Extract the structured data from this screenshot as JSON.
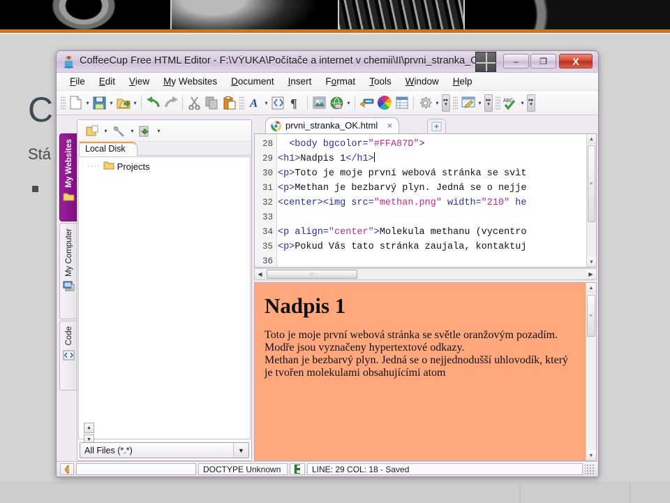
{
  "slide": {
    "title_visible": "C",
    "subtitle_visible": "Stá",
    "accent_color": "#c8761f",
    "background_color": "#d3d3d3"
  },
  "window": {
    "title": "CoffeeCup Free HTML Editor - F:\\VÝUKA\\Počítače a internet v chemii\\II\\prvni_stranka_OK.html",
    "app_icon": "coffeecup-icon",
    "controls": {
      "minimize": "–",
      "maximize": "❐",
      "close": "X"
    }
  },
  "menubar": {
    "items": [
      {
        "label": "File",
        "accel": "F"
      },
      {
        "label": "Edit",
        "accel": "E"
      },
      {
        "label": "View",
        "accel": "V"
      },
      {
        "label": "My Websites",
        "accel": "M"
      },
      {
        "label": "Document",
        "accel": "D"
      },
      {
        "label": "Insert",
        "accel": "I"
      },
      {
        "label": "Format",
        "accel": "o"
      },
      {
        "label": "Tools",
        "accel": "T"
      },
      {
        "label": "Window",
        "accel": "W"
      },
      {
        "label": "Help",
        "accel": "H"
      }
    ]
  },
  "toolbar": {
    "buttons": [
      "new-page-icon",
      "save-icon",
      "open-folder-icon",
      "undo-icon",
      "redo-icon",
      "cut-icon",
      "copy-icon",
      "paste-icon",
      "font-icon",
      "code-cleanup-icon",
      "paragraph-mark-icon",
      "insert-image-icon",
      "insert-link-icon",
      "anchor-icon",
      "color-wheel-icon",
      "insert-table-icon",
      "settings-gear-icon",
      "preview-edit-icon",
      "spellcheck-icon"
    ]
  },
  "sidebar": {
    "vertical_tabs": [
      {
        "label": "My Websites",
        "icon": "folder-icon",
        "active": true
      },
      {
        "label": "My Computer",
        "icon": "computer-icon",
        "active": false
      },
      {
        "label": "Code",
        "icon": "code-icon",
        "active": false
      }
    ],
    "panel_toolbar": [
      "open-project-icon",
      "tools-wrench-icon",
      "upload-icon"
    ],
    "tab": "Local Disk",
    "tree": [
      {
        "label": "Projects",
        "icon": "folder-icon"
      }
    ],
    "filter": {
      "value": "All Files (*.*)",
      "options": [
        "All Files (*.*)"
      ]
    }
  },
  "document_tab": {
    "label": "prvni_stranka_OK.html",
    "icon": "chrome-icon",
    "close": "×",
    "new_tab": "+"
  },
  "editor": {
    "first_line": 28,
    "lines": [
      {
        "num": 28,
        "segments": [
          {
            "t": "  ",
            "c": "p"
          },
          {
            "t": "<body bgcolor=",
            "c": "tg"
          },
          {
            "t": "\"#FFA87D\"",
            "c": "vl"
          },
          {
            "t": ">",
            "c": "tg"
          }
        ]
      },
      {
        "num": 29,
        "segments": [
          {
            "t": "<h1>",
            "c": "tg"
          },
          {
            "t": "Nadpis 1",
            "c": "p"
          },
          {
            "t": "</h1>",
            "c": "tg"
          },
          {
            "t": "|",
            "c": "caret"
          }
        ]
      },
      {
        "num": 30,
        "segments": [
          {
            "t": "<p>",
            "c": "tg"
          },
          {
            "t": "Toto je moje první webová stránka se svìt",
            "c": "p"
          }
        ]
      },
      {
        "num": 31,
        "segments": [
          {
            "t": "<p>",
            "c": "tg"
          },
          {
            "t": "Methan je bezbarvý plyn. Jedná se o nejje",
            "c": "p"
          }
        ]
      },
      {
        "num": 32,
        "segments": [
          {
            "t": "<center><img src=",
            "c": "tg"
          },
          {
            "t": "\"methan.png\"",
            "c": "vl"
          },
          {
            "t": " width=",
            "c": "tg"
          },
          {
            "t": "\"210\"",
            "c": "vl"
          },
          {
            "t": " he",
            "c": "tg"
          }
        ]
      },
      {
        "num": 33,
        "segments": []
      },
      {
        "num": 34,
        "segments": [
          {
            "t": "<p align=",
            "c": "tg"
          },
          {
            "t": "\"center\"",
            "c": "vl"
          },
          {
            "t": ">",
            "c": "tg"
          },
          {
            "t": "Molekula methanu (vycentro",
            "c": "p"
          }
        ]
      },
      {
        "num": 35,
        "segments": [
          {
            "t": "<p>",
            "c": "tg"
          },
          {
            "t": "Pokud Vás tato stránka zaujala, kontaktuj",
            "c": "p"
          }
        ]
      },
      {
        "num": 36,
        "segments": []
      }
    ]
  },
  "preview": {
    "background_color": "#FFA87D",
    "heading": "Nadpis 1",
    "paragraphs": [
      "Toto je moje první webová stránka se světle oranžovým pozadím. Modře jsou vyznačeny hypertextové odkazy.",
      "Methan je bezbarvý plyn. Jedná se o nejjednodušší uhlovodík, který je tvořen molekulami obsahujícími atom"
    ]
  },
  "statusbar": {
    "doctype": "DOCTYPE Unknown",
    "save_icon": "save-icon",
    "position": "LINE: 29  COL: 18 - Saved"
  }
}
